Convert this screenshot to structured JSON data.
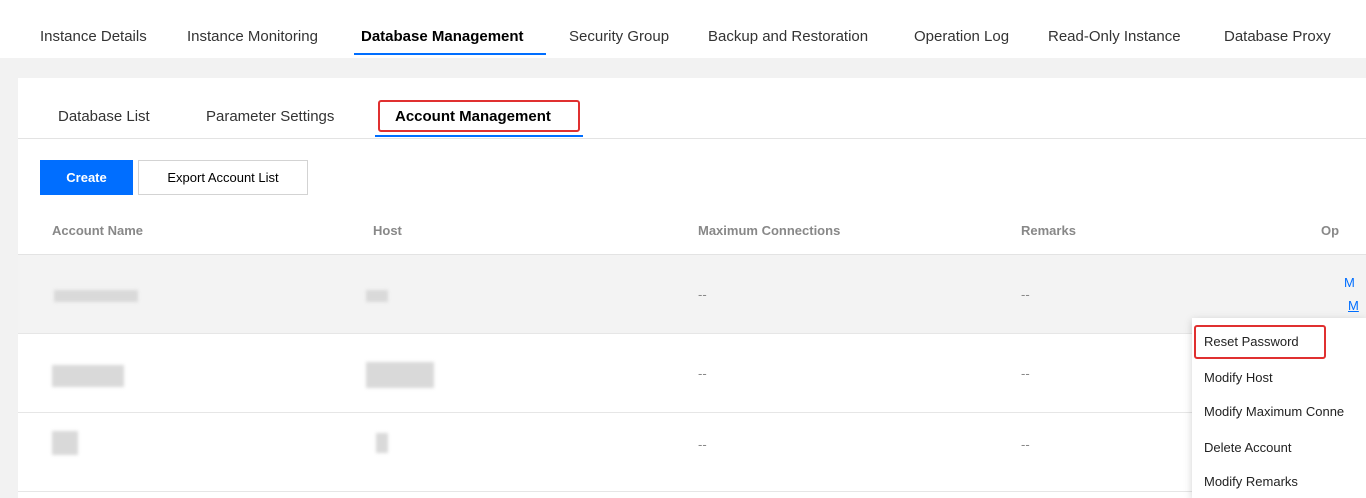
{
  "top_tabs": [
    {
      "label": "Instance Details"
    },
    {
      "label": "Instance Monitoring"
    },
    {
      "label": "Database Management"
    },
    {
      "label": "Security Group"
    },
    {
      "label": "Backup and Restoration"
    },
    {
      "label": "Operation Log"
    },
    {
      "label": "Read-Only Instance"
    },
    {
      "label": "Database Proxy"
    }
  ],
  "active_top_tab": "Database Management",
  "sub_tabs": [
    {
      "label": "Database List"
    },
    {
      "label": "Parameter Settings"
    },
    {
      "label": "Account Management"
    }
  ],
  "active_sub_tab": "Account Management",
  "toolbar": {
    "create_label": "Create",
    "export_label": "Export Account List"
  },
  "table": {
    "columns": [
      "Account Name",
      "Host",
      "Maximum Connections",
      "Remarks",
      "Op"
    ],
    "rows": [
      {
        "max_connections": "--",
        "remarks": "--",
        "op_links": [
          "M",
          "M"
        ]
      },
      {
        "max_connections": "--",
        "remarks": "--"
      },
      {
        "max_connections": "--",
        "remarks": "--"
      }
    ]
  },
  "dropdown_menu": {
    "items": [
      {
        "label": "Reset Password"
      },
      {
        "label": "Modify Host"
      },
      {
        "label": "Modify Maximum Conne"
      },
      {
        "label": "Delete Account"
      },
      {
        "label": "Modify Remarks"
      }
    ],
    "highlighted_item": "Reset Password"
  },
  "colors": {
    "accent": "#006eff",
    "highlight_border": "#e03030",
    "page_bg": "#f2f2f2"
  }
}
